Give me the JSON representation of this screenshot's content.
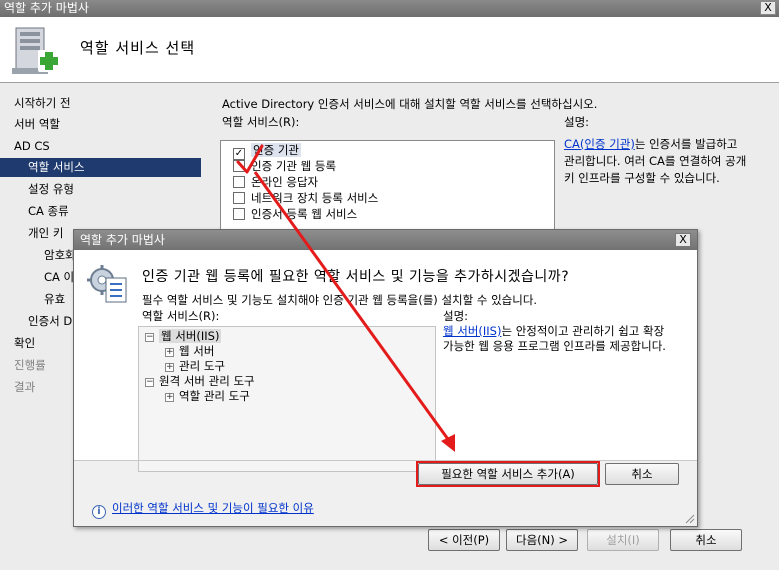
{
  "window": {
    "title": "역할 추가 마법사",
    "close_glyph": "X"
  },
  "header": {
    "title": "역할 서비스 선택"
  },
  "nav": {
    "items": [
      {
        "label": "시작하기 전"
      },
      {
        "label": "서버 역할"
      },
      {
        "label": "AD CS"
      },
      {
        "label": "역할 서비스"
      },
      {
        "label": "설정 유형"
      },
      {
        "label": "CA 종류"
      },
      {
        "label": "개인 키"
      },
      {
        "label": "암호화"
      },
      {
        "label": "CA 이"
      },
      {
        "label": "유효"
      },
      {
        "label": "인증서 D"
      },
      {
        "label": "확인"
      },
      {
        "label": "진행률"
      },
      {
        "label": "결과"
      }
    ]
  },
  "content": {
    "instruction": "Active Directory 인증서 서비스에 대해 설치할 역할 서비스를 선택하십시오.",
    "list_label": "역할 서비스(R):",
    "roles": [
      {
        "label": "인증 기관",
        "checked": true
      },
      {
        "label": "인증 기관 웹 등록",
        "checked": false
      },
      {
        "label": "온라인 응답자",
        "checked": false
      },
      {
        "label": "네트워크 장치 등록 서비스",
        "checked": false
      },
      {
        "label": "인증서 등록 웹 서비스",
        "checked": false
      }
    ],
    "description_label": "설명:",
    "description_link": "CA(인증 기관)",
    "description_text": "는 인증서를 발급하고 관리합니다. 여러 CA를 연결하여 공개 키 인프라를 구성할 수 있습니다."
  },
  "buttons": {
    "prev": "< 이전(P)",
    "next": "다음(N) >",
    "install": "설치(I)",
    "cancel": "취소"
  },
  "dialog": {
    "title": "역할 추가 마법사",
    "close_glyph": "X",
    "question": "인증 기관 웹 등록에 필요한 역할 서비스 및 기능을 추가하시겠습니까?",
    "subtext": "필수 역할 서비스 및 기능도 설치해야 인증 기관 웹 등록을(를) 설치할 수 있습니다.",
    "list_label": "역할 서비스(R):",
    "tree": [
      {
        "label": "웹 서버(IIS)",
        "level": 0,
        "expander": "−"
      },
      {
        "label": "웹 서버",
        "level": 1,
        "expander": "+"
      },
      {
        "label": "관리 도구",
        "level": 1,
        "expander": "+"
      },
      {
        "label": "원격 서버 관리 도구",
        "level": 0,
        "expander": "−"
      },
      {
        "label": "역할 관리 도구",
        "level": 1,
        "expander": "+"
      }
    ],
    "description_label": "설명:",
    "description_link": "웹 서버(IIS)",
    "description_text": "는 안정적이고 관리하기 쉽고 확장 가능한 웹 응용 프로그램 인프라를 제공합니다.",
    "add_button": "필요한 역할 서비스 추가(A)",
    "cancel_button": "취소",
    "help_link": "이러한 역할 서비스 및 기능이 필요한 이유"
  },
  "colors": {
    "nav_selected": "#1e3a6e",
    "annotation_red": "#e31b1b",
    "link": "#0033cc"
  }
}
